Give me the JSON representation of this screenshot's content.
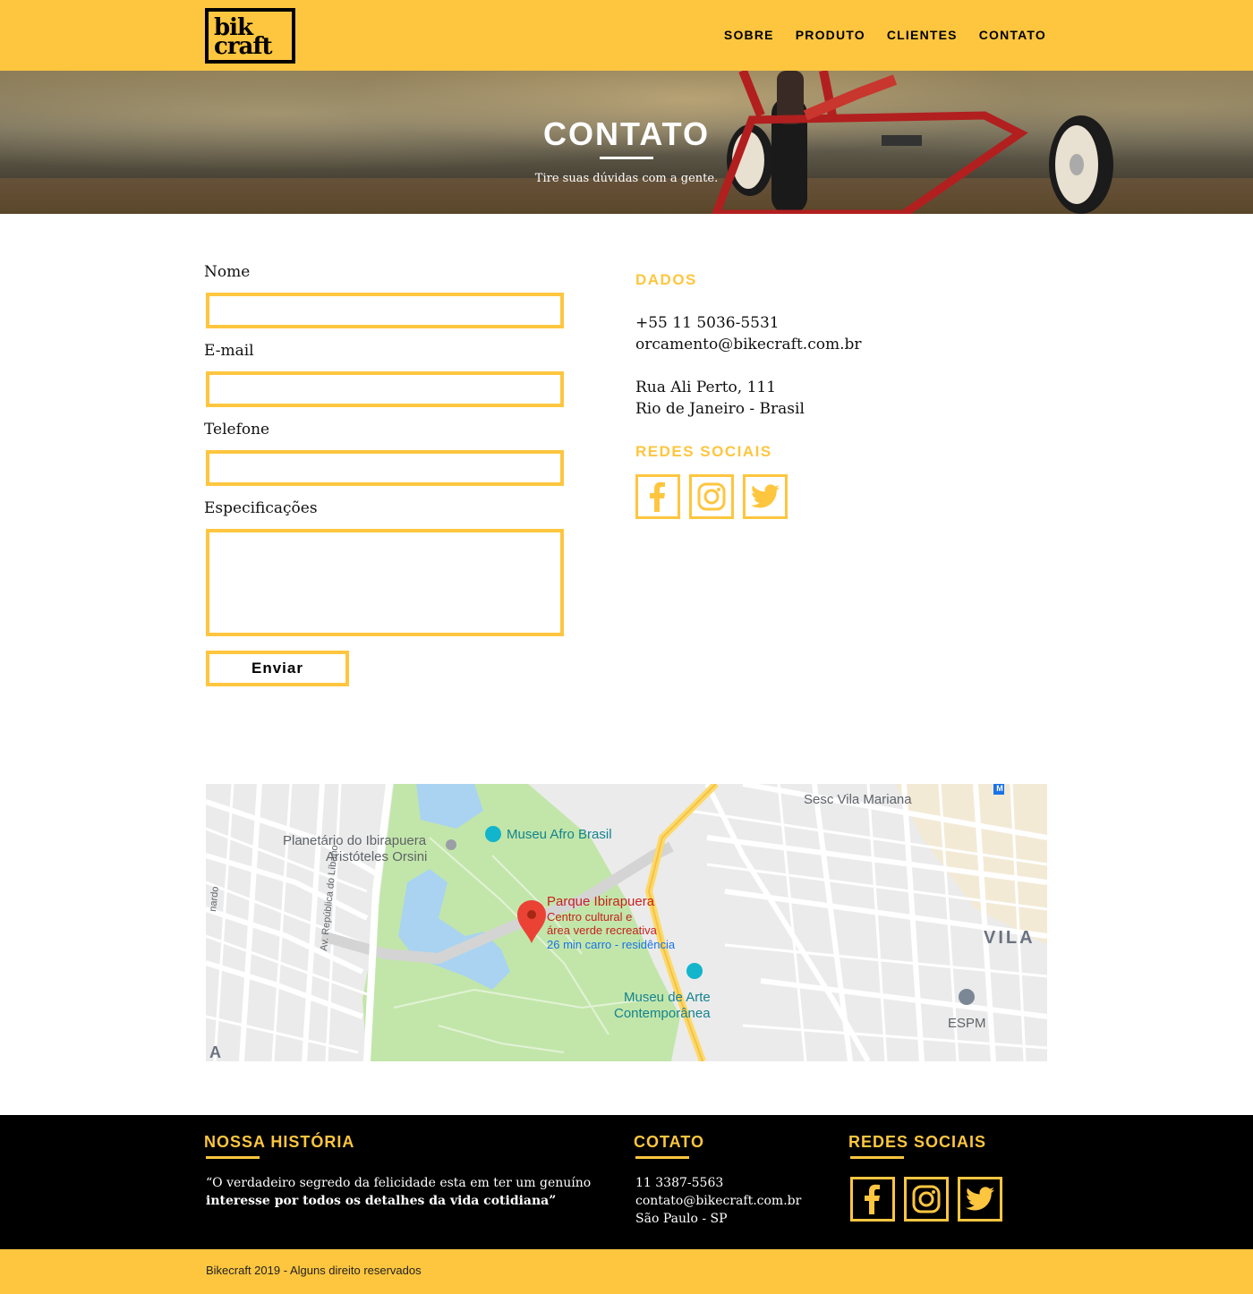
{
  "brand": {
    "logo_line1": "bik",
    "logo_line2": "craft"
  },
  "nav": {
    "items": [
      "SOBRE",
      "PRODUTO",
      "CLIENTES",
      "CONTATO"
    ]
  },
  "hero": {
    "title": "CONTATO",
    "subtitle": "Tire suas dúvidas com a gente."
  },
  "form": {
    "name_label": "Nome",
    "name_value": "",
    "email_label": "E-mail",
    "email_value": "",
    "phone_label": "Telefone",
    "phone_value": "",
    "specs_label": "Especificações",
    "specs_value": "",
    "submit_label": "Enviar"
  },
  "dados": {
    "title": "DADOS",
    "phone": "+55 11 5036-5531",
    "email": "orcamento@bikecraft.com.br",
    "address_line1": "Rua Ali Perto, 111",
    "address_line2": "Rio de Janeiro - Brasil",
    "social_title": "REDES SOCIAIS",
    "social_icons": [
      "facebook-icon",
      "instagram-icon",
      "twitter-icon"
    ]
  },
  "map": {
    "labels": {
      "sesc": "Sesc Vila Mariana",
      "planetario_1": "Planetário do Ibirapuera",
      "planetario_2": "Aristóteles Orsini",
      "museu_afro": "Museu Afro Brasil",
      "parque_name": "Parque Ibirapuera",
      "parque_desc1": "Centro cultural e",
      "parque_desc2": "área verde recreativa",
      "parque_route": "26 min carro - residência",
      "vila": "VILA",
      "mac_1": "Museu de Arte",
      "mac_2": "Contemporânea",
      "espm": "ESPM",
      "avenue": "Av. República do Líbano",
      "edge_left": "nardo",
      "edge_bottom": "A",
      "metro": "M"
    }
  },
  "footer": {
    "history_title": "NOSSA HISTÓRIA",
    "quote_line1": "“O verdadeiro segredo da felicidade esta em ter um genuíno",
    "quote_line2": "interesse por todos os detalhes da vida cotidiana”",
    "contact_title": "COTATO",
    "contact_phone": "11 3387-5563",
    "contact_email": "contato@bikecraft.com.br",
    "contact_city": "São Paulo - SP",
    "social_title": "REDES SOCIAIS",
    "copyright": "Bikecraft 2019 - Alguns direito reservados"
  },
  "colors": {
    "accent": "#FEC63F",
    "dark": "#000000",
    "map_park": "#c2e6a9",
    "map_water": "#a9d3f1",
    "map_road_major": "#fcd96b",
    "pin": "#ea4335"
  }
}
